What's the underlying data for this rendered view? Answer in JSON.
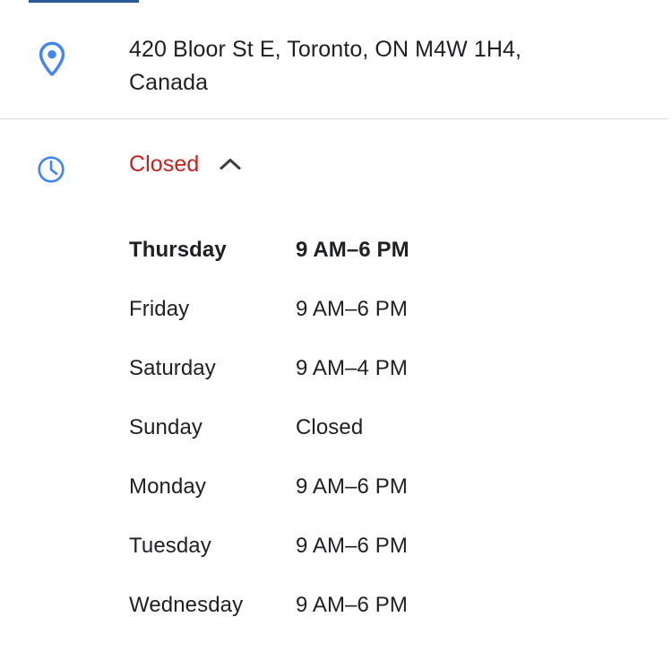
{
  "tab": {
    "indicator_color": "#2d5898"
  },
  "address": {
    "icon": "location-pin-icon",
    "icon_color": "#4285f4",
    "text": "420 Bloor St E, Toronto, ON M4W 1H4, Canada"
  },
  "hours": {
    "icon": "clock-icon",
    "icon_color": "#4285f4",
    "status_label": "Closed",
    "status_color": "#c5221f",
    "toggle_icon": "chevron-up-icon",
    "expanded": true,
    "rows": [
      {
        "day": "Thursday",
        "time": "9 AM–6 PM",
        "today": true
      },
      {
        "day": "Friday",
        "time": "9 AM–6 PM",
        "today": false
      },
      {
        "day": "Saturday",
        "time": "9 AM–4 PM",
        "today": false
      },
      {
        "day": "Sunday",
        "time": "Closed",
        "today": false
      },
      {
        "day": "Monday",
        "time": "9 AM–6 PM",
        "today": false
      },
      {
        "day": "Tuesday",
        "time": "9 AM–6 PM",
        "today": false
      },
      {
        "day": "Wednesday",
        "time": "9 AM–6 PM",
        "today": false
      }
    ]
  }
}
